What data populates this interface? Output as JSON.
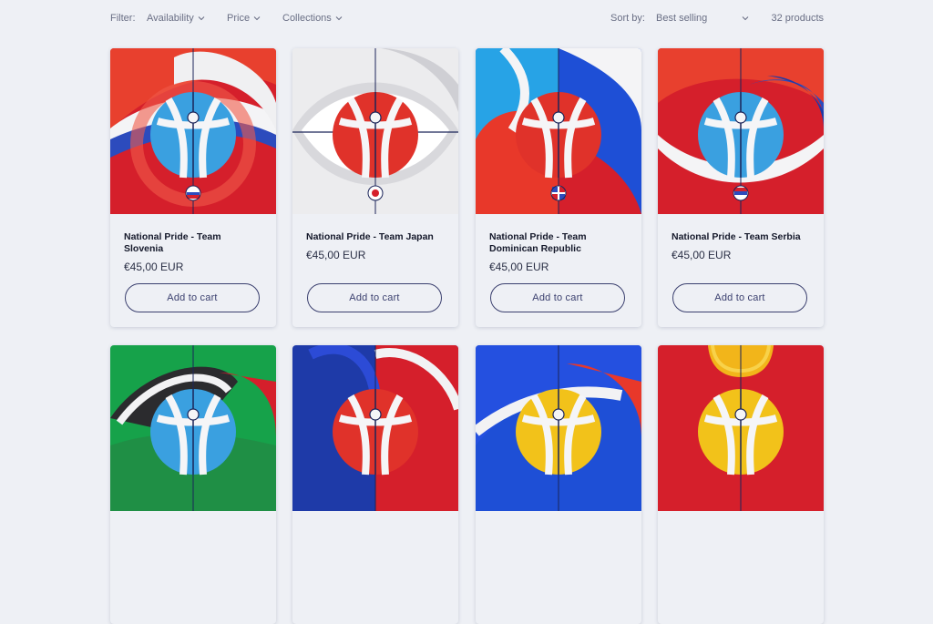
{
  "filters": {
    "label": "Filter:",
    "availability": "Availability",
    "price": "Price",
    "collections": "Collections"
  },
  "sort": {
    "label": "Sort by:",
    "value": "Best selling"
  },
  "product_count": "32 products",
  "products": [
    {
      "title": "National Pride - Team Slovenia",
      "price": "€45,00 EUR",
      "cta": "Add to cart"
    },
    {
      "title": "National Pride - Team Japan",
      "price": "€45,00 EUR",
      "cta": "Add to cart"
    },
    {
      "title": "National Pride - Team Dominican Republic",
      "price": "€45,00 EUR",
      "cta": "Add to cart"
    },
    {
      "title": "National Pride - Team Serbia",
      "price": "€45,00 EUR",
      "cta": "Add to cart"
    }
  ],
  "colors": {
    "accent": "#3a3f6e",
    "background": "#eef0f5"
  },
  "icons": [
    "chevron-down-icon",
    "basketball-icon",
    "flag-icon"
  ]
}
